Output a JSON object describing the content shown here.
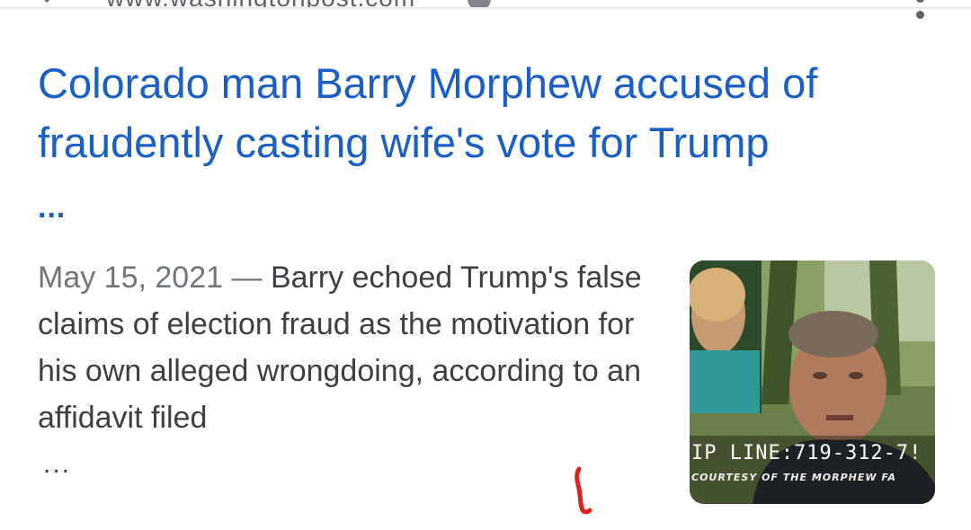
{
  "result": {
    "source_url": "www.washingtonpost.com",
    "headline": "Colorado man Barry Morphew accused of fraudently casting wife's vote for Trump",
    "headline_ellipsis": "...",
    "date": "May 15, 2021",
    "separator": "—",
    "snippet": "Barry echoed Trump's false claims of election fraud as the motivation for his own alleged wrongdoing, according to an affidavit filed",
    "snippet_ellipsis": "...",
    "thumbnail": {
      "caption_line": "IP LINE:719-312-7!",
      "credit_line": "COURTESY OF THE MORPHEW FA"
    }
  },
  "icons": {
    "favicon": "site-favicon-icon",
    "about_result": "info-icon",
    "more_options": "more-vert-icon"
  },
  "colors": {
    "link": "#1a5fc7",
    "text": "#3c4043",
    "date": "#70757a",
    "annotation": "#e0201a"
  }
}
